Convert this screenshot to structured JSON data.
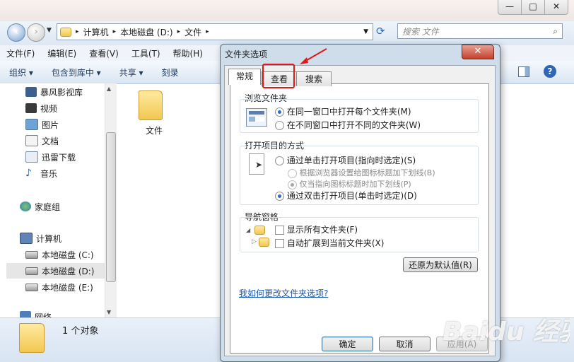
{
  "window": {
    "minimize": "—",
    "maximize": "□",
    "close": "✕"
  },
  "address": {
    "crumbs": [
      "计算机",
      "本地磁盘 (D:)",
      "文件"
    ],
    "search_placeholder": "搜索 文件"
  },
  "menubar": [
    "文件(F)",
    "编辑(E)",
    "查看(V)",
    "工具(T)",
    "帮助(H)"
  ],
  "toolbar": [
    "组织 ▾",
    "包含到库中 ▾",
    "共享 ▾",
    "刻录"
  ],
  "sidebar": {
    "items": [
      {
        "label": "暴风影视库",
        "icon": "video-library-icon"
      },
      {
        "label": "视频",
        "icon": "video-icon"
      },
      {
        "label": "图片",
        "icon": "picture-icon"
      },
      {
        "label": "文档",
        "icon": "document-icon"
      },
      {
        "label": "迅雷下载",
        "icon": "download-icon"
      },
      {
        "label": "音乐",
        "icon": "music-icon"
      },
      {
        "label": "家庭组",
        "icon": "homegroup-icon"
      },
      {
        "label": "计算机",
        "icon": "computer-icon"
      },
      {
        "label": "本地磁盘 (C:)",
        "icon": "disk-icon"
      },
      {
        "label": "本地磁盘 (D:)",
        "icon": "disk-icon"
      },
      {
        "label": "本地磁盘 (E:)",
        "icon": "disk-icon"
      },
      {
        "label": "网络",
        "icon": "network-icon"
      }
    ]
  },
  "content": {
    "folder_name": "文件"
  },
  "status": {
    "count": "1 个对象"
  },
  "dialog": {
    "title": "文件夹选项",
    "close": "✕",
    "tabs": [
      "常规",
      "查看",
      "搜索"
    ],
    "browse": {
      "title": "浏览文件夹",
      "options": [
        "在同一窗口中打开每个文件夹(M)",
        "在不同窗口中打开不同的文件夹(W)"
      ]
    },
    "open": {
      "title": "打开项目的方式",
      "single": "通过单击打开项目(指向时选定)(S)",
      "sub1": "根据浏览器设置给图标标题加下划线(B)",
      "sub2": "仅当指向图标标题时加下划线(P)",
      "double": "通过双击打开项目(单击时选定)(D)"
    },
    "nav": {
      "title": "导航窗格",
      "show_all": "显示所有文件夹(F)",
      "auto_expand": "自动扩展到当前文件夹(X)"
    },
    "restore": "还原为默认值(R)",
    "help_link": "我如何更改文件夹选项?",
    "ok": "确定",
    "cancel": "取消",
    "apply": "应用(A)"
  },
  "watermark": "Baidu 经验",
  "colors": {
    "annotation": "#e01818",
    "link": "#1a58b5"
  }
}
